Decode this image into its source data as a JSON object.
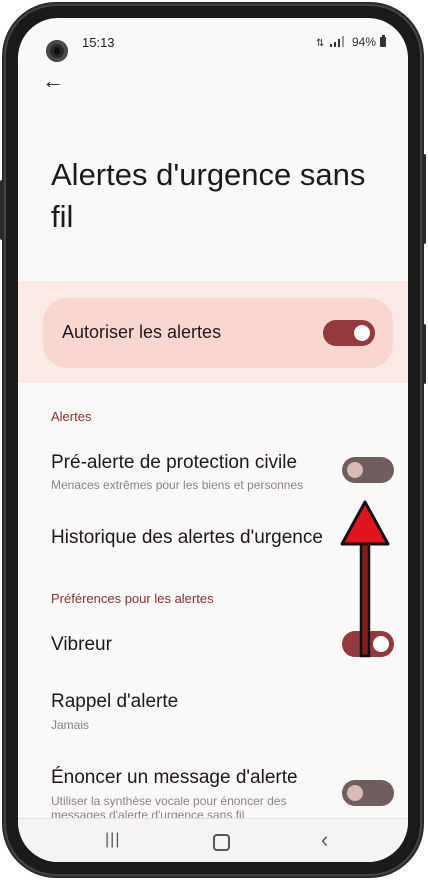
{
  "status_bar": {
    "time": "15:13",
    "battery": "94%",
    "signal_icons": "signal-icons"
  },
  "header": {
    "title": "Alertes d'urgence sans fil"
  },
  "allow_alerts": {
    "label": "Autoriser les alertes",
    "enabled": true
  },
  "sections": {
    "alerts_heading": "Alertes",
    "prefs_heading": "Préférences pour les alertes"
  },
  "items": {
    "civil_protection": {
      "title": "Pré-alerte de protection civile",
      "subtitle": "Menaces extrêmes pour les biens et personnes",
      "enabled": false
    },
    "history": {
      "title": "Historique des alertes d'urgence"
    },
    "vibration": {
      "title": "Vibreur",
      "enabled": true
    },
    "reminder": {
      "title": "Rappel d'alerte",
      "subtitle": "Jamais"
    },
    "speak": {
      "title": "Énoncer un message d'alerte",
      "subtitle": "Utiliser la synthèse vocale pour énoncer des messages d'alerte d'urgence sans fil",
      "enabled": false
    }
  },
  "colors": {
    "accent": "#953a3c",
    "toggle_off": "#705e5f",
    "section_heading": "#8c2f32",
    "annotation_arrow": "#e0141c"
  }
}
